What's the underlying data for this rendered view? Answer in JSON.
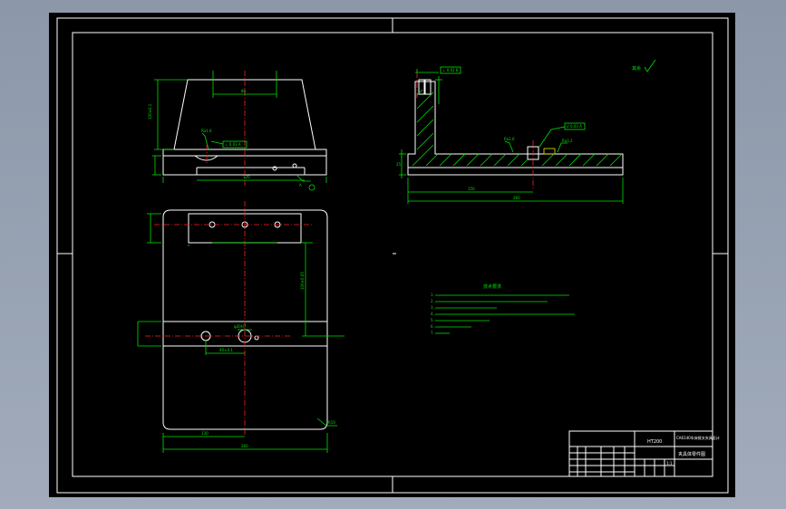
{
  "drawing": {
    "tech_requirements_title": "技术要求",
    "tech_requirements": [
      "1.",
      "2.",
      "3.",
      "4.",
      "5.",
      "6.",
      "7."
    ],
    "title_block": {
      "material": "HT200",
      "project": "CA6140车床拨叉夹具设计",
      "drawing_name": "夹具体零件图",
      "scale": "1:1"
    },
    "roughness_note": "其余",
    "colors": {
      "background": "#000000",
      "outline": "#ffffff",
      "dimension": "#00e000",
      "centerline": "#ff2020",
      "hatch": "#00e000"
    }
  }
}
